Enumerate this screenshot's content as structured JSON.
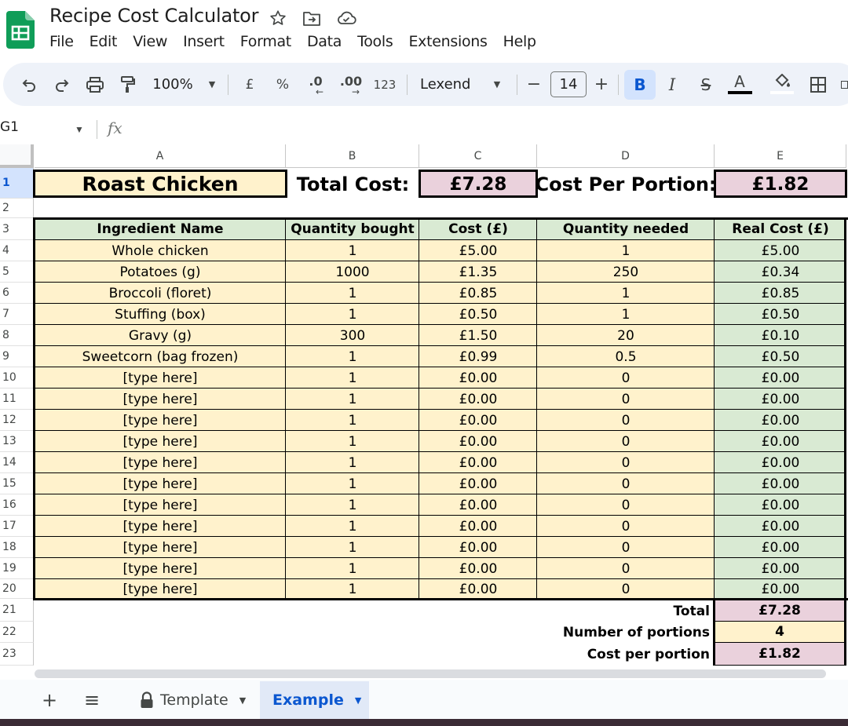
{
  "app": {
    "title": "Recipe Cost Calculator",
    "menu": [
      "File",
      "Edit",
      "View",
      "Insert",
      "Format",
      "Data",
      "Tools",
      "Extensions",
      "Help"
    ]
  },
  "toolbar": {
    "zoom": "100%",
    "currency_label": "£",
    "percent_label": "%",
    "decrease_decimal_label": ".0",
    "increase_decimal_label": ".00",
    "number_format_label": "123",
    "font": "Lexend",
    "font_size": "14",
    "minus_label": "−",
    "plus_label": "+",
    "bold_label": "B",
    "italic_label": "I",
    "strike_label": "S",
    "text_color_label": "A"
  },
  "formula_bar": {
    "name_box": "G1",
    "fx_label": "fx"
  },
  "columns": [
    "A",
    "B",
    "C",
    "D",
    "E"
  ],
  "rows": [
    "1",
    "2",
    "3",
    "4",
    "5",
    "6",
    "7",
    "8",
    "9",
    "10",
    "11",
    "12",
    "13",
    "14",
    "15",
    "16",
    "17",
    "18",
    "19",
    "20",
    "21",
    "22",
    "23"
  ],
  "header_row": {
    "recipe_name": "Roast Chicken",
    "total_cost_label": "Total Cost:",
    "total_cost_value": "£7.28",
    "cost_per_portion_label": "Cost Per Portion:",
    "cost_per_portion_value": "£1.82"
  },
  "table": {
    "headers": [
      "Ingredient Name",
      "Quantity bought",
      "Cost (£)",
      "Quantity needed",
      "Real Cost (£)"
    ],
    "rows": [
      [
        "Whole chicken",
        "1",
        "£5.00",
        "1",
        "£5.00"
      ],
      [
        "Potatoes (g)",
        "1000",
        "£1.35",
        "250",
        "£0.34"
      ],
      [
        "Broccoli (floret)",
        "1",
        "£0.85",
        "1",
        "£0.85"
      ],
      [
        "Stuffing (box)",
        "1",
        "£0.50",
        "1",
        "£0.50"
      ],
      [
        "Gravy (g)",
        "300",
        "£1.50",
        "20",
        "£0.10"
      ],
      [
        "Sweetcorn (bag frozen)",
        "1",
        "£0.99",
        "0.5",
        "£0.50"
      ],
      [
        "[type here]",
        "1",
        "£0.00",
        "0",
        "£0.00"
      ],
      [
        "[type here]",
        "1",
        "£0.00",
        "0",
        "£0.00"
      ],
      [
        "[type here]",
        "1",
        "£0.00",
        "0",
        "£0.00"
      ],
      [
        "[type here]",
        "1",
        "£0.00",
        "0",
        "£0.00"
      ],
      [
        "[type here]",
        "1",
        "£0.00",
        "0",
        "£0.00"
      ],
      [
        "[type here]",
        "1",
        "£0.00",
        "0",
        "£0.00"
      ],
      [
        "[type here]",
        "1",
        "£0.00",
        "0",
        "£0.00"
      ],
      [
        "[type here]",
        "1",
        "£0.00",
        "0",
        "£0.00"
      ],
      [
        "[type here]",
        "1",
        "£0.00",
        "0",
        "£0.00"
      ],
      [
        "[type here]",
        "1",
        "£0.00",
        "0",
        "£0.00"
      ],
      [
        "[type here]",
        "1",
        "£0.00",
        "0",
        "£0.00"
      ]
    ]
  },
  "summary": [
    {
      "label": "Total",
      "value": "£7.28"
    },
    {
      "label": "Number of portions",
      "value": "4"
    },
    {
      "label": "Cost per portion",
      "value": "£1.82"
    }
  ],
  "sheets": {
    "add_label": "+",
    "all_sheets_label": "≡",
    "tabs": [
      {
        "name": "Template",
        "locked": true,
        "active": false
      },
      {
        "name": "Example",
        "locked": false,
        "active": true
      }
    ]
  },
  "colors": {
    "cream": "#fff2cc",
    "green": "#d9ead3",
    "pink": "#ead1dc",
    "active_tab_text": "#0b57d0",
    "sheets_green": "#0f9d58"
  }
}
